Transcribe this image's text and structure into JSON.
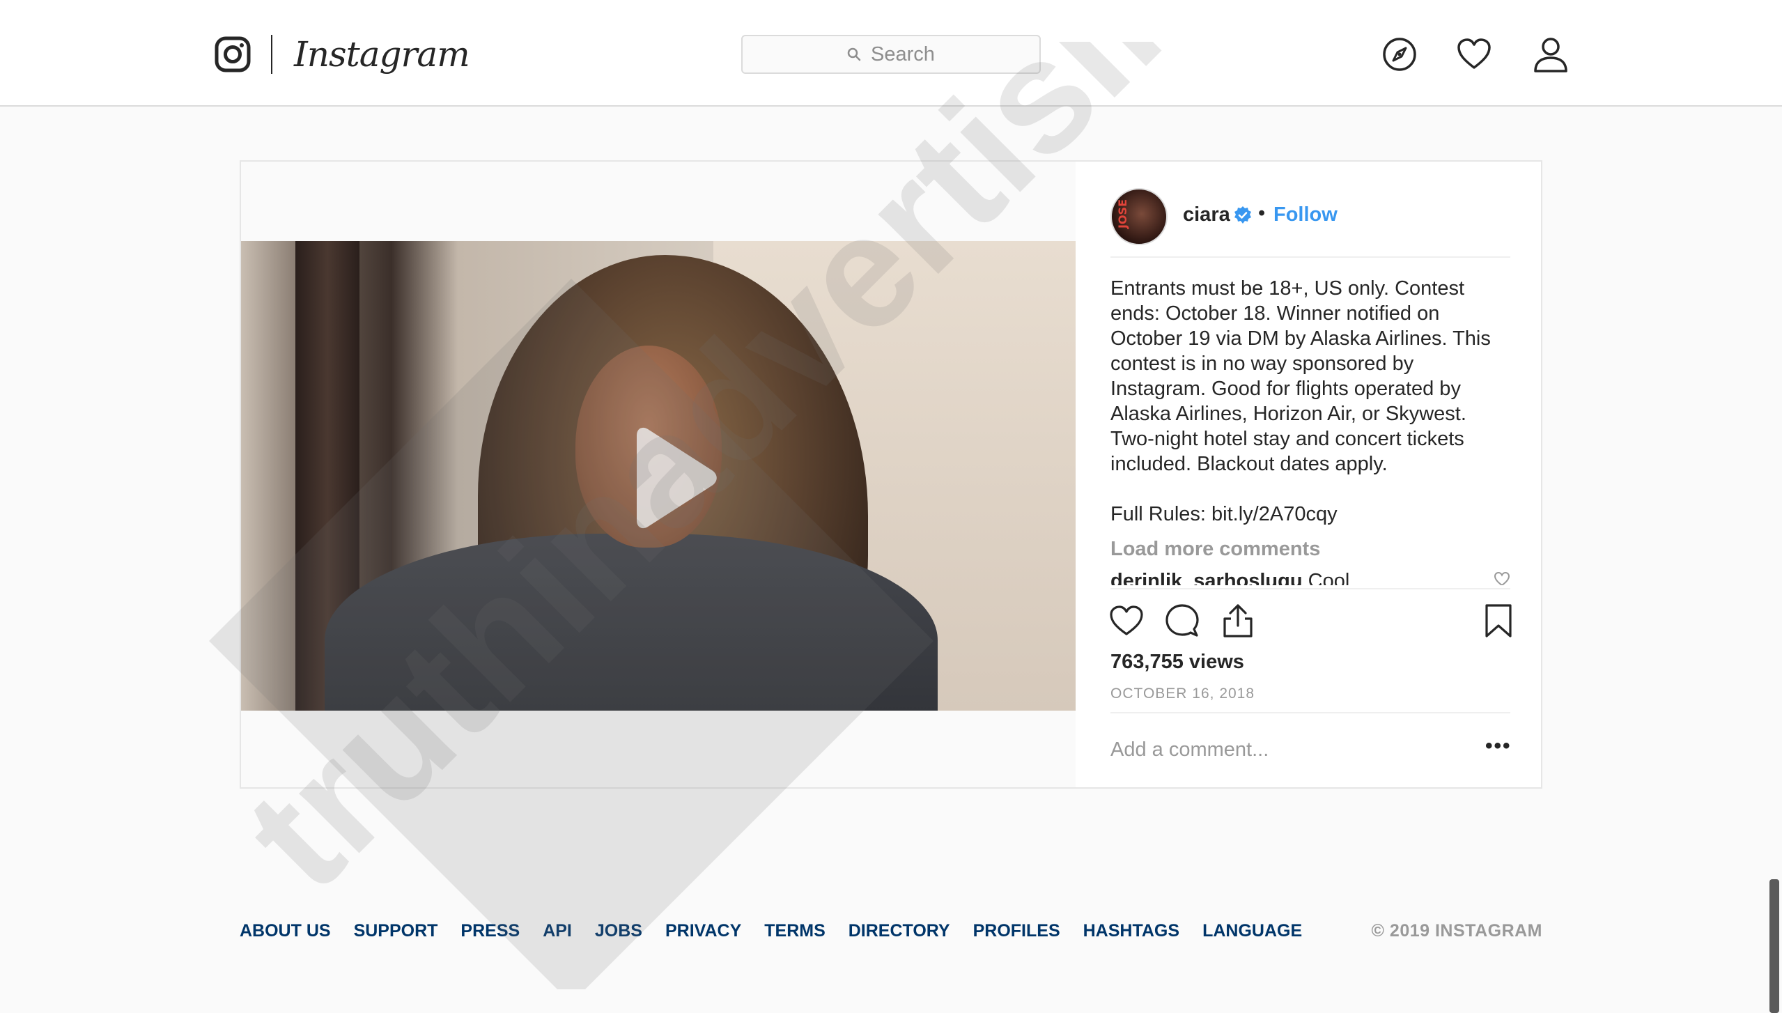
{
  "header": {
    "brand": "Instagram",
    "search_placeholder": "Search"
  },
  "post": {
    "username": "ciara",
    "follow_label": "Follow",
    "separator": "•",
    "avatar_text": "JOSE",
    "caption": "Entrants must be 18+, US only. Contest ends: October 18. Winner notified on October 19 via DM by Alaska Airlines. This contest is in no way sponsored by Instagram. Good for flights operated by Alaska Airlines, Horizon Air, or Skywest. Two-night hotel stay and concert tickets included. Blackout dates apply.\n\nFull Rules: bit.ly/2A70cqy",
    "load_more": "Load more comments",
    "comment": {
      "user": "derinlik_sarhosluqu",
      "text": "Cool"
    },
    "views": "763,755 views",
    "date": "OCTOBER 16, 2018",
    "add_comment_placeholder": "Add a comment...",
    "more_label": "•••"
  },
  "footer": {
    "links": [
      "ABOUT US",
      "SUPPORT",
      "PRESS",
      "API",
      "JOBS",
      "PRIVACY",
      "TERMS",
      "DIRECTORY",
      "PROFILES",
      "HASHTAGS",
      "LANGUAGE"
    ],
    "copyright": "© 2019 INSTAGRAM"
  },
  "watermark_text": "truthinadvertising.org",
  "icons": {
    "logo": "instagram-camera-icon",
    "explore": "compass-icon",
    "activity": "heart-icon",
    "profile": "person-icon",
    "verified": "verified-badge-icon",
    "play": "play-icon",
    "like": "heart-outline-icon",
    "comment": "speech-bubble-icon",
    "share": "share-upload-icon",
    "save": "bookmark-icon"
  },
  "colors": {
    "link_blue": "#3897f0",
    "footer_link": "#003569",
    "muted": "#999999"
  }
}
